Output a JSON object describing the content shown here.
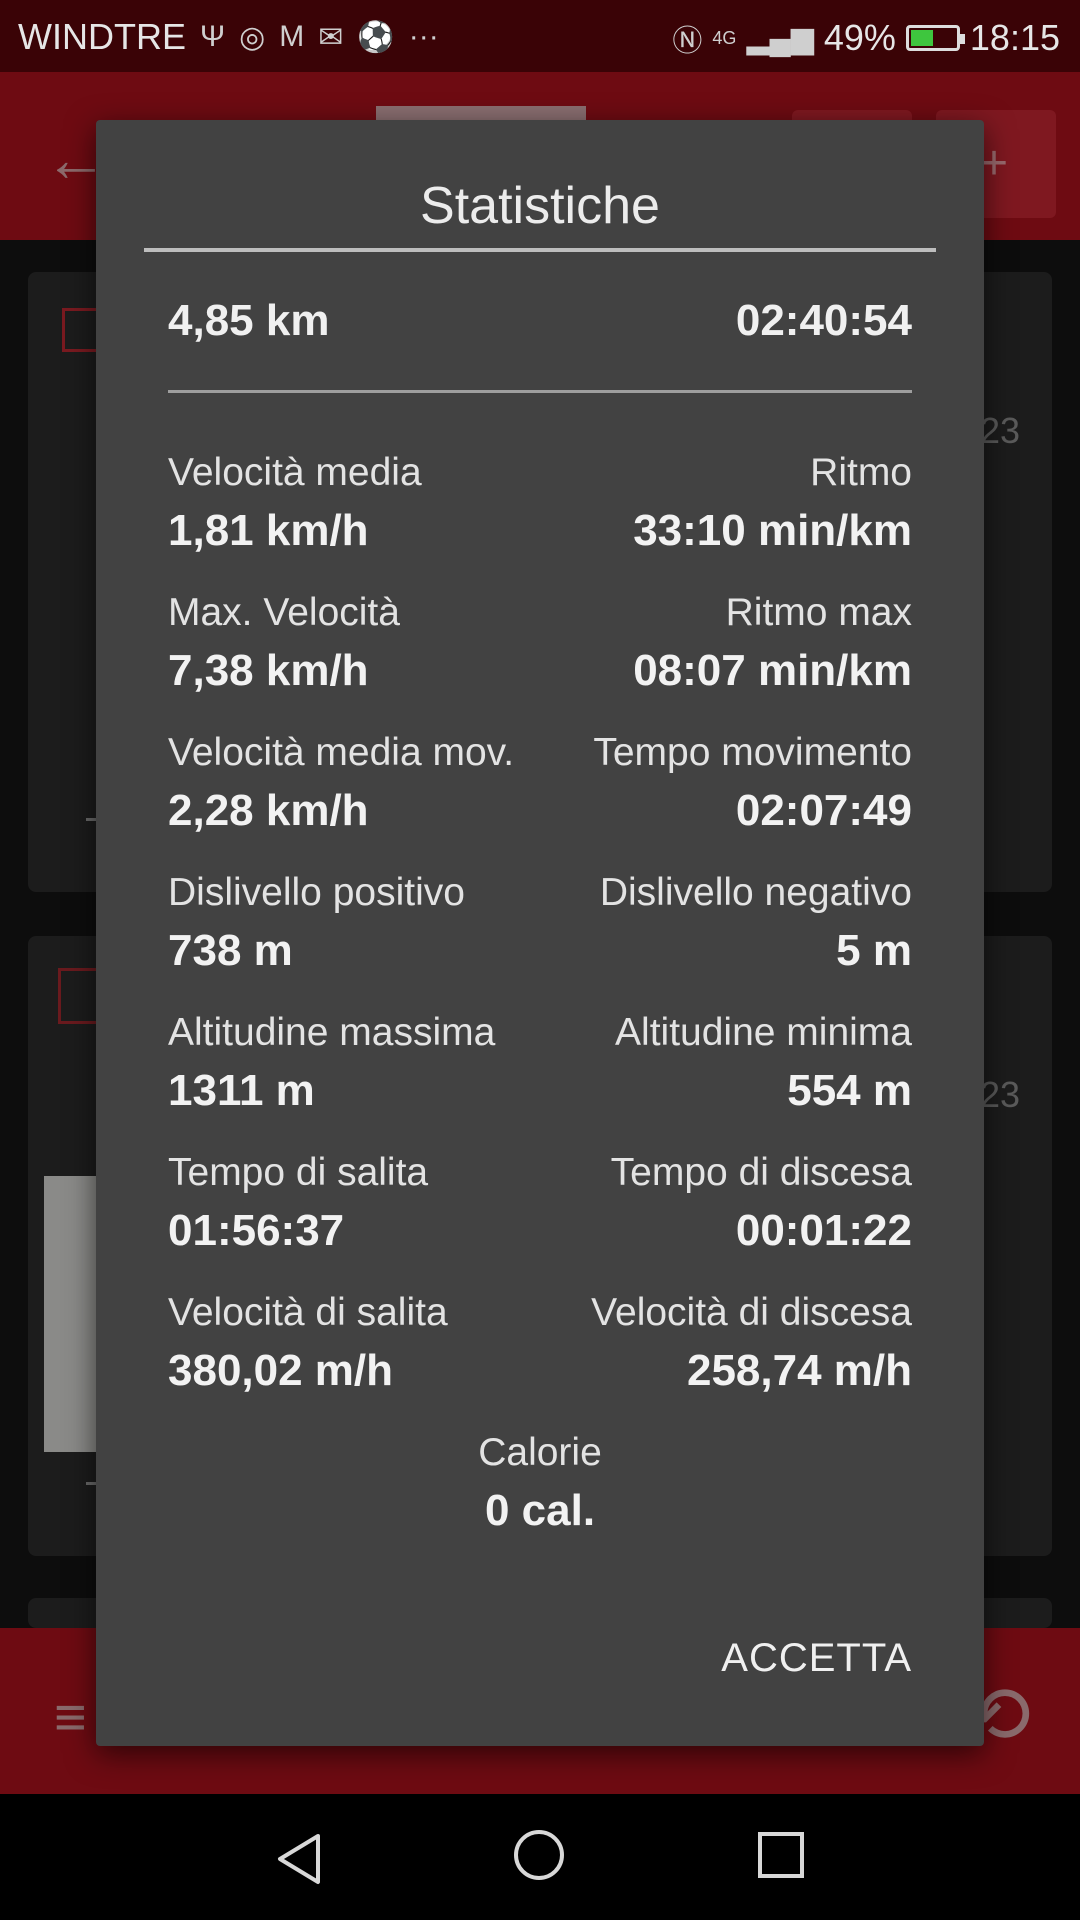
{
  "status_bar": {
    "carrier": "WINDTRE",
    "icons": [
      "usb-icon",
      "toyota-icon",
      "gmail-icon",
      "mail-settings-icon",
      "soccer-icon",
      "more-dots-icon"
    ],
    "network": "4G",
    "battery": "49%",
    "battery_level": 0.49,
    "time": "18:15"
  },
  "background": {
    "card_number_1": "23",
    "card_number_2": "23"
  },
  "dialog": {
    "title": "Statistiche",
    "distance": "4,85 km",
    "total_time": "02:40:54",
    "rows": [
      {
        "left_label": "Velocità media",
        "left_value": "1,81 km/h",
        "right_label": "Ritmo",
        "right_value": "33:10 min/km"
      },
      {
        "left_label": "Max. Velocità",
        "left_value": "7,38 km/h",
        "right_label": "Ritmo max",
        "right_value": "08:07 min/km"
      },
      {
        "left_label": "Velocità media mov.",
        "left_value": "2,28 km/h",
        "right_label": "Tempo movimento",
        "right_value": "02:07:49"
      },
      {
        "left_label": "Dislivello positivo",
        "left_value": "738 m",
        "right_label": "Dislivello negativo",
        "right_value": "5 m"
      },
      {
        "left_label": "Altitudine massima",
        "left_value": "1311 m",
        "right_label": "Altitudine minima",
        "right_value": "554 m"
      },
      {
        "left_label": "Tempo di salita",
        "left_value": "01:56:37",
        "right_label": "Tempo di discesa",
        "right_value": "00:01:22"
      },
      {
        "left_label": "Velocità di salita",
        "left_value": "380,02 m/h",
        "right_label": "Velocità di discesa",
        "right_value": "258,74 m/h"
      }
    ],
    "calories_label": "Calorie",
    "calories_value": "0 cal.",
    "accept_label": "ACCETTA"
  }
}
